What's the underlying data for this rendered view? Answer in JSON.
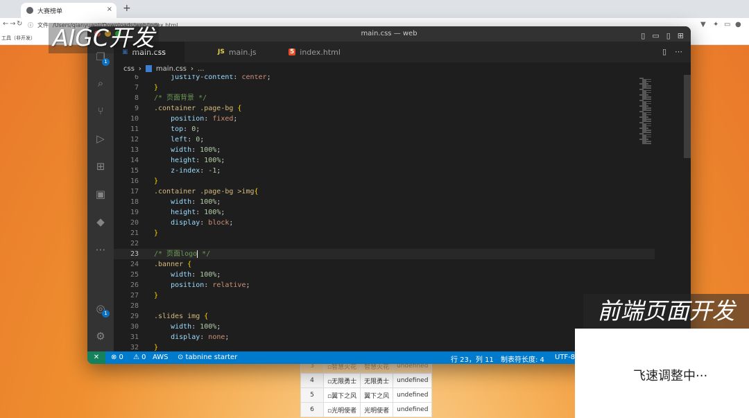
{
  "browser": {
    "tab_title": "大赛榜单",
    "tab_close": "×",
    "new_tab": "+",
    "address_label": "文件",
    "address": "/Users/qianyuanli/Downloads/web/index.html",
    "bookmarks": [
      "工具（非开发）"
    ]
  },
  "page_table": [
    {
      "idx": "3",
      "img": "智慧火花",
      "name": "智慧火花",
      "val": "undefined"
    },
    {
      "idx": "4",
      "img": "无限勇士",
      "name": "无限勇士",
      "val": "undefined"
    },
    {
      "idx": "5",
      "img": "翼下之风",
      "name": "翼下之风",
      "val": "undefined"
    },
    {
      "idx": "6",
      "img": "光明使者",
      "name": "光明使者",
      "val": "undefined"
    }
  ],
  "editor": {
    "window_title": "main.css — web",
    "tabs": [
      {
        "type": "",
        "label": "main.css",
        "dirty": true
      },
      {
        "type": "JS",
        "label": "main.js"
      },
      {
        "type": "5",
        "label": "index.html"
      }
    ],
    "breadcrumb": {
      "folder": "css",
      "file": "main.css",
      "more": "..."
    },
    "explorer_badge": "1",
    "accounts_badge": "1",
    "lines": [
      {
        "n": "6",
        "t": "    justify-content: center;"
      },
      {
        "n": "7",
        "t": "}"
      },
      {
        "n": "8",
        "t": "/* 页面背景 */"
      },
      {
        "n": "9",
        "t": ".container .page-bg {"
      },
      {
        "n": "10",
        "t": "    position: fixed;"
      },
      {
        "n": "11",
        "t": "    top: 0;"
      },
      {
        "n": "12",
        "t": "    left: 0;"
      },
      {
        "n": "13",
        "t": "    width: 100%;"
      },
      {
        "n": "14",
        "t": "    height: 100%;"
      },
      {
        "n": "15",
        "t": "    z-index: -1;"
      },
      {
        "n": "16",
        "t": "}"
      },
      {
        "n": "17",
        "t": ".container .page-bg >img{"
      },
      {
        "n": "18",
        "t": "    width: 100%;"
      },
      {
        "n": "19",
        "t": "    height: 100%;"
      },
      {
        "n": "20",
        "t": "    display: block;"
      },
      {
        "n": "21",
        "t": "}"
      },
      {
        "n": "22",
        "t": ""
      },
      {
        "n": "23",
        "t": "/* 页面logo */"
      },
      {
        "n": "24",
        "t": ".banner {"
      },
      {
        "n": "25",
        "t": "    width: 100%;"
      },
      {
        "n": "26",
        "t": "    position: relative;"
      },
      {
        "n": "27",
        "t": "}"
      },
      {
        "n": "28",
        "t": ""
      },
      {
        "n": "29",
        "t": ".slides img {"
      },
      {
        "n": "30",
        "t": "    width: 100%;"
      },
      {
        "n": "31",
        "t": "    display: none;"
      },
      {
        "n": "32",
        "t": "}"
      }
    ],
    "current_line": "23",
    "status": {
      "errors": "⊗ 0",
      "warnings": "⚠ 0",
      "aws": "AWS",
      "tabnine": "⊙ tabnine starter",
      "position": "行 23，列 11",
      "tab_size": "制表符长度: 4",
      "encoding": "UTF-8"
    }
  },
  "overlays": {
    "top_left": "AIGC开发",
    "right": "前端页面开发",
    "box_text": "飞速调整中···"
  },
  "colors": {
    "status_bar": "#007acc",
    "editor_bg": "#1e1e1e"
  }
}
